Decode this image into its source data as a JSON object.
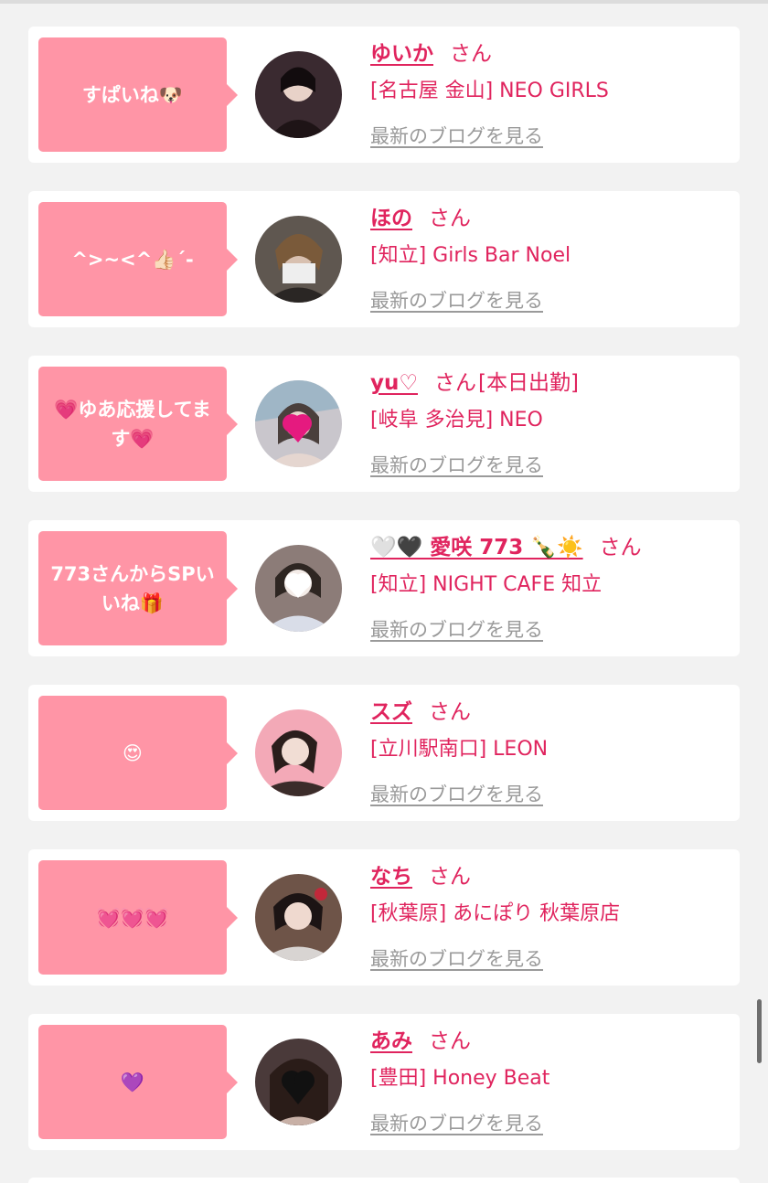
{
  "colors": {
    "accent": "#e0245e",
    "bubble": "#ff95a6",
    "link_gray": "#9a9a9a",
    "background": "#f2f2f2"
  },
  "honorific": "さん",
  "blog_link_label": "最新のブログを見る",
  "entries": [
    {
      "message": "すぱいね🐶",
      "name": "ゆいか",
      "extra": "",
      "shop": "[名古屋 金山] NEO GIRLS",
      "avatar_tone": "#3a2a30"
    },
    {
      "message": "^>~<^👍🏻´-",
      "name": "ほの",
      "extra": "",
      "shop": "[知立] Girls Bar Noel",
      "avatar_tone": "#6b5e55"
    },
    {
      "message": "💗ゆあ応援してます💗",
      "name": "yu♡",
      "extra": "[本日出勤]",
      "shop": "[岐阜 多治見] NEO",
      "avatar_tone": "#b7b3b8"
    },
    {
      "message": "773さんからSPいいね🎁",
      "name": "🤍🖤 愛咲 773 🍾☀️",
      "extra": "",
      "shop": "[知立] NIGHT CAFE 知立",
      "avatar_tone": "#9c8a86"
    },
    {
      "message": "😍",
      "name": "スズ",
      "extra": "",
      "shop": "[立川駅南口] LEON",
      "avatar_tone": "#f3a9b7"
    },
    {
      "message": "💓💓💓",
      "name": "なち",
      "extra": "",
      "shop": "[秋葉原] あにぽり 秋葉原店",
      "avatar_tone": "#7a5a4e"
    },
    {
      "message": "💜",
      "name": "あみ",
      "extra": "",
      "shop": "[豊田] Honey Beat",
      "avatar_tone": "#4a3a3a"
    }
  ]
}
